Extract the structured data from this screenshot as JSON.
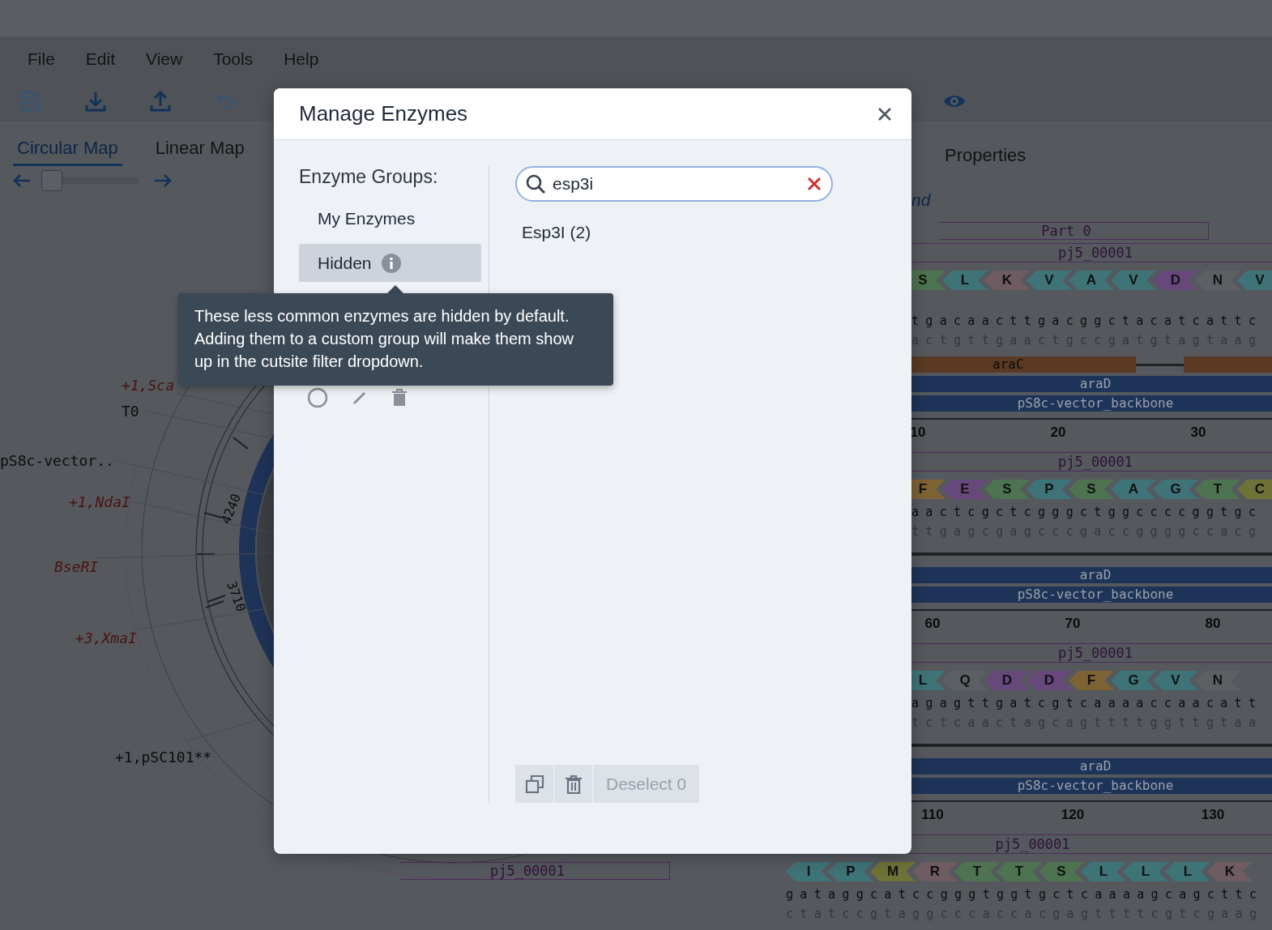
{
  "menu": [
    "File",
    "Edit",
    "View",
    "Tools",
    "Help"
  ],
  "toolbar": [
    {
      "kind": "save",
      "disabled": true
    },
    {
      "kind": "download",
      "disabled": false
    },
    {
      "kind": "upload",
      "disabled": false
    },
    {
      "kind": "undo",
      "disabled": true
    },
    {
      "kind": "eye",
      "disabled": false
    }
  ],
  "view_tabs": [
    {
      "label": "Circular Map",
      "selected": true
    },
    {
      "label": "Linear Map",
      "selected": false
    }
  ],
  "zoom_slider": {
    "level": 0.0
  },
  "circular_map": {
    "labels": [
      {
        "text": "+1,Sca",
        "kind": "enzyme"
      },
      {
        "text": "T0",
        "kind": "feature"
      },
      {
        "text": "pS8c-vector..",
        "kind": "feature"
      },
      {
        "text": "+1,NdaI",
        "kind": "enzyme"
      },
      {
        "text": "BseRI",
        "kind": "enzyme"
      },
      {
        "text": "+3,XmaI",
        "kind": "enzyme"
      },
      {
        "text": "+1,pSC101**",
        "kind": "feature"
      },
      {
        "text": "pj5_00001",
        "kind": "part"
      }
    ],
    "ring_numbers": [
      "4240",
      "3710"
    ]
  },
  "side_tabs": [
    {
      "label": "Properties",
      "selected": false
    }
  ],
  "sequence_rows": [
    {
      "fragment": "nd",
      "above": [
        {
          "kind": "part",
          "label": "Part 0"
        },
        {
          "kind": "line",
          "label": "pj5_00001"
        }
      ],
      "amino_acids": [
        {
          "letter": "S",
          "color": "#4d7350"
        },
        {
          "letter": "L",
          "color": "#3e7378"
        },
        {
          "letter": "K",
          "color": "#6e5c60"
        },
        {
          "letter": "V",
          "color": "#3e7378"
        },
        {
          "letter": "A",
          "color": "#3e7378"
        },
        {
          "letter": "V",
          "color": "#3e7378"
        },
        {
          "letter": "D",
          "color": "#66487a"
        },
        {
          "letter": "N",
          "color": "#5c6065"
        },
        {
          "letter": "V",
          "color": "#3e7378"
        }
      ],
      "top": "tgacaacttgacggctacatcattc",
      "bottom": "actgttgaactgccgatgtagtaag",
      "below": [
        {
          "kind": "split",
          "label": "araC"
        },
        {
          "kind": "bar",
          "label": "araD"
        },
        {
          "kind": "bar",
          "label": "pS8c-vector_backbone"
        }
      ],
      "ticks": [
        "10",
        "20",
        "30"
      ]
    },
    {
      "above": [
        {
          "kind": "line",
          "label": "pj5_00001"
        }
      ],
      "amino_acids": [
        {
          "letter": "F",
          "color": "#7d6234"
        },
        {
          "letter": "E",
          "color": "#66487a"
        },
        {
          "letter": "S",
          "color": "#4d7350"
        },
        {
          "letter": "P",
          "color": "#3e7378"
        },
        {
          "letter": "S",
          "color": "#4d7350"
        },
        {
          "letter": "A",
          "color": "#3e7378"
        },
        {
          "letter": "G",
          "color": "#3e7378"
        },
        {
          "letter": "T",
          "color": "#4d7350"
        },
        {
          "letter": "C",
          "color": "#6f7236"
        }
      ],
      "top": "aactcgctcgggctggccccggtgc",
      "bottom": "ttgagcgagcccgaccggggccacg",
      "below": [
        {
          "kind": "rule"
        },
        {
          "kind": "bar",
          "label": "araD"
        },
        {
          "kind": "bar",
          "label": "pS8c-vector_backbone"
        }
      ],
      "ticks": [
        "60",
        "70",
        "80"
      ]
    },
    {
      "above": [
        {
          "kind": "line",
          "label": "pj5_00001"
        }
      ],
      "amino_acids": [
        {
          "letter": "L",
          "color": "#3e7378"
        },
        {
          "letter": "Q",
          "color": "#5c6065"
        },
        {
          "letter": "D",
          "color": "#66487a"
        },
        {
          "letter": "D",
          "color": "#66487a"
        },
        {
          "letter": "F",
          "color": "#7d6234"
        },
        {
          "letter": "G",
          "color": "#3e7378"
        },
        {
          "letter": "V",
          "color": "#3e7378"
        },
        {
          "letter": "N",
          "color": "#5c6065"
        }
      ],
      "top": "agagttgatcgtcaaaaccaacatt",
      "bottom": "tctcaactagcagttttggttgtaa",
      "below": [
        {
          "kind": "rule"
        },
        {
          "kind": "bar",
          "label": "araD"
        },
        {
          "kind": "bar",
          "label": "pS8c-vector_backbone"
        }
      ],
      "ticks": [
        "110",
        "120",
        "130"
      ]
    },
    {
      "above": [
        {
          "kind": "line",
          "label": "pj5_00001"
        }
      ],
      "amino_acids": [
        {
          "letter": "I",
          "color": "#3e7378"
        },
        {
          "letter": "P",
          "color": "#3e7378"
        },
        {
          "letter": "M",
          "color": "#6f7236"
        },
        {
          "letter": "R",
          "color": "#6e5c60"
        },
        {
          "letter": "T",
          "color": "#4d7350"
        },
        {
          "letter": "T",
          "color": "#4d7350"
        },
        {
          "letter": "S",
          "color": "#4d7350"
        },
        {
          "letter": "L",
          "color": "#3e7378"
        },
        {
          "letter": "L",
          "color": "#3e7378"
        },
        {
          "letter": "L",
          "color": "#3e7378"
        },
        {
          "letter": "K",
          "color": "#6e5c60"
        }
      ],
      "top": "gataggcatccgggtggtgctcaaaagcagcttc",
      "bottom": "ctatccgtaggcccaccacgagttttcgtcgaag",
      "below": [],
      "ticks": []
    }
  ],
  "dialog": {
    "title": "Manage Enzymes",
    "groups_heading": "Enzyme Groups:",
    "groups": [
      {
        "label": "My Enzymes",
        "selected": false,
        "info": false
      },
      {
        "label": "Hidden",
        "selected": true,
        "info": true
      }
    ],
    "tooltip": "These less common enzymes are hidden by default. Adding them to a custom group will make them show up in the cutsite filter dropdown.",
    "search": {
      "value": "esp3i"
    },
    "results": [
      "Esp3I (2)"
    ],
    "deselect": {
      "label": "Deselect 0",
      "disabled": true
    }
  }
}
